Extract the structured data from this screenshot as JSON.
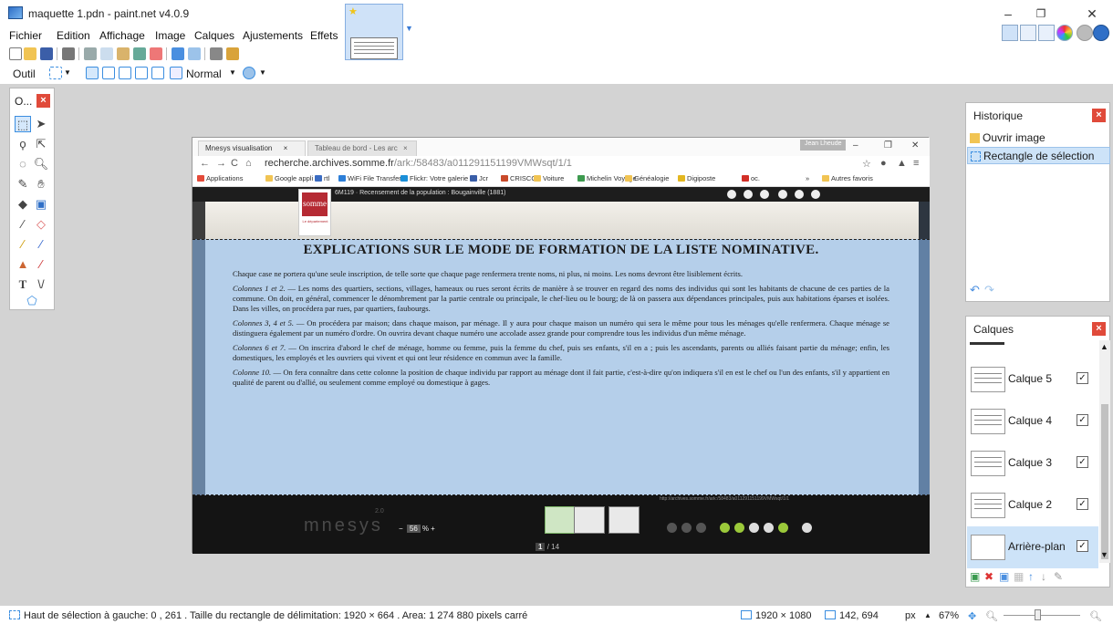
{
  "window": {
    "title": "maquette 1.pdn - paint.net v4.0.9",
    "minimize": "–",
    "maximize": "❐",
    "close": "✕"
  },
  "menu": [
    "Fichier",
    "Edition",
    "Affichage",
    "Image",
    "Calques",
    "Ajustements",
    "Effets"
  ],
  "toolbar": {
    "tool_label": "Outil :",
    "blend_mode": "Normal"
  },
  "tools_panel": {
    "title": "O...",
    "close": "×"
  },
  "browser": {
    "tabs": [
      "Mnesys visualisation",
      "Tableau de bord - Les arc"
    ],
    "user_chip": "Jean Lheude",
    "url_host": "recherche.archives.somme.fr",
    "url_path": "/ark:/58483/a011291151199VMWsqt/1/1",
    "bookmarks": [
      "Applications",
      "Google appli",
      "rtl",
      "WiFi File Transfer",
      "Flickr: Votre galerie",
      "Jcr",
      "CRISCO",
      "Voiture",
      "Michelin Voyage",
      "Généalogie",
      "Digiposte",
      "oc.",
      "»",
      "Autres favoris"
    ],
    "bookmark_colors": [
      "#e44b3a",
      "#f1c453",
      "#3b6cc2",
      "#2d7fd8",
      "#1a8fd8",
      "#3a5ea8",
      "#c94a2a",
      "#f1c453",
      "#3d9a4f",
      "#f1c453",
      "#e3b720",
      "#d22f27",
      "#ffffff",
      "#f1c453"
    ]
  },
  "viewer": {
    "title": "6M119 · Recensement de la population : Bougainville (1881)",
    "logo_text": "somme",
    "logo_sub": "Le département",
    "brand": "mnesys",
    "brand_version": "2.0",
    "zoom_minus": "−",
    "zoom_value": "56",
    "zoom_unit": "%",
    "zoom_plus": "+",
    "page_current": "1",
    "page_total": "/ 14",
    "small_url": "http://archives.somme.fr/ark:/58483/a011291151199VMWsqt/1/1"
  },
  "document": {
    "heading": "EXPLICATIONS SUR LE MODE DE FORMATION DE LA LISTE NOMINATIVE.",
    "paragraphs": [
      {
        "lead": "",
        "text": "Chaque case ne portera qu'une seule inscription, de telle sorte que chaque page renfermera trente noms, ni plus, ni moins. Les noms devront être lisiblement écrits."
      },
      {
        "lead": "Colonnes 1 et 2.",
        "text": " — Les noms des quartiers, sections, villages, hameaux ou rues seront écrits de manière à se trouver en regard des noms des individus qui sont les habitants de chacune de ces parties de la commune. On doit, en général, commencer le dénombrement par la partie centrale ou principale, le chef-lieu ou le bourg; de là on passera aux dépendances principales, puis aux habitations éparses et isolées. Dans les villes, on procédera par rues, par quartiers, faubourgs."
      },
      {
        "lead": "Colonnes 3, 4 et 5.",
        "text": " — On procédera par maison; dans chaque maison, par ménage. Il y aura pour chaque maison un numéro qui sera le même pour tous les ménages qu'elle renfermera. Chaque ménage se distinguera également par un numéro d'ordre. On ouvrira devant chaque numéro une accolade assez grande pour comprendre tous les individus d'un même ménage."
      },
      {
        "lead": "Colonnes 6 et 7.",
        "text": " — On inscrira d'abord le chef de ménage, homme ou femme, puis la femme du chef, puis ses enfants, s'il en a ; puis les ascendants, parents ou alliés faisant partie du ménage; enfin, les domestiques, les employés et les ouvriers qui vivent et qui ont leur résidence en commun avec la famille."
      },
      {
        "lead": "Colonne 10.",
        "text": " — On fera connaître dans cette colonne la position de chaque individu par rapport au ménage dont il fait partie, c'est-à-dire qu'on indiquera s'il en est le chef ou l'un des enfants, s'il y appartient en qualité de parent ou d'allié, ou seulement comme employé ou domestique à gages."
      }
    ]
  },
  "history": {
    "title": "Historique",
    "close": "×",
    "items": [
      "Ouvrir image",
      "Rectangle de sélection"
    ]
  },
  "layers": {
    "title": "Calques",
    "close": "×",
    "items": [
      {
        "name": "Calque 5",
        "visible": true
      },
      {
        "name": "Calque 4",
        "visible": true
      },
      {
        "name": "Calque 3",
        "visible": true
      },
      {
        "name": "Calque 2",
        "visible": true
      },
      {
        "name": "Arrière-plan",
        "visible": true
      }
    ]
  },
  "status": {
    "selection": "Haut de sélection à gauche: 0 , 261 . Taille du rectangle de délimitation: 1920 × 664 . Area: 1 274 880 pixels carré",
    "image_size": "1920 × 1080",
    "cursor": "142, 694",
    "unit": "px",
    "zoom": "67%"
  }
}
